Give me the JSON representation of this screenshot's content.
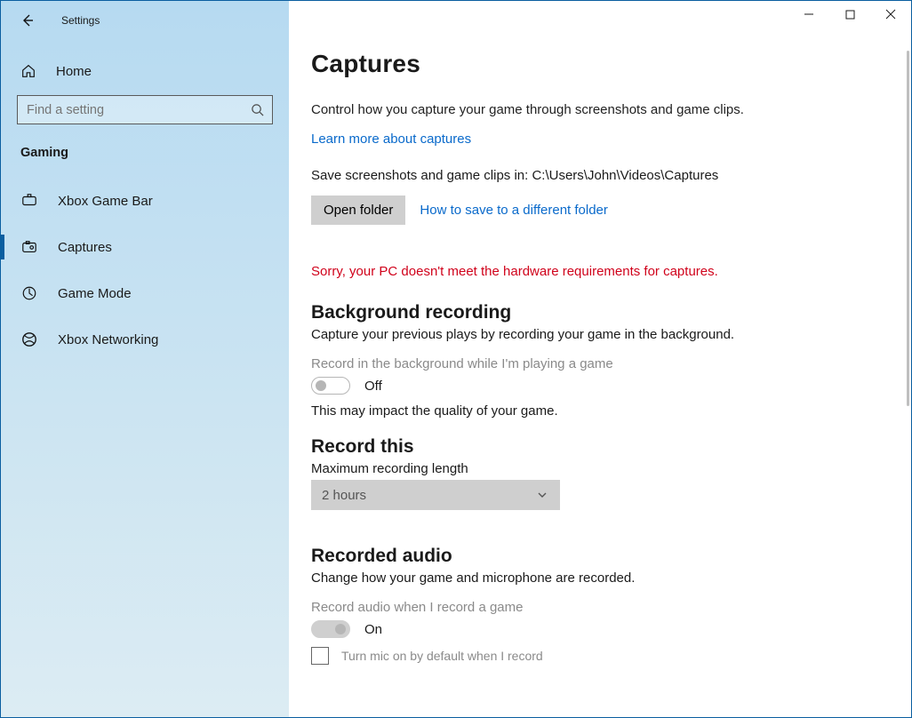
{
  "window": {
    "app_name": "Settings"
  },
  "sidebar": {
    "home": "Home",
    "search_placeholder": "Find a setting",
    "category": "Gaming",
    "items": [
      {
        "label": "Xbox Game Bar",
        "active": false
      },
      {
        "label": "Captures",
        "active": true
      },
      {
        "label": "Game Mode",
        "active": false
      },
      {
        "label": "Xbox Networking",
        "active": false
      }
    ]
  },
  "main": {
    "title": "Captures",
    "description": "Control how you capture your game through screenshots and game clips.",
    "learn_more": "Learn more about captures",
    "save_path_label": "Save screenshots and game clips in: C:\\Users\\John\\Videos\\Captures",
    "open_folder_btn": "Open folder",
    "how_to_save": "How to save to a different folder",
    "error": "Sorry, your PC doesn't meet the hardware requirements for captures.",
    "bg_recording": {
      "title": "Background recording",
      "subtitle": "Capture your previous plays by recording your game in the background.",
      "toggle_label": "Record in the background while I'm playing a game",
      "state": "Off",
      "note": "This may impact the quality of your game."
    },
    "record_this": {
      "title": "Record this",
      "label": "Maximum recording length",
      "value": "2 hours"
    },
    "recorded_audio": {
      "title": "Recorded audio",
      "subtitle": "Change how your game and microphone are recorded.",
      "toggle_label": "Record audio when I record a game",
      "state": "On",
      "mic_checkbox": "Turn mic on by default when I record"
    }
  }
}
